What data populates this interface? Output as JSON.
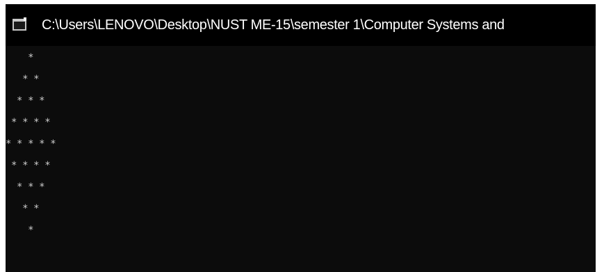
{
  "window": {
    "title": "C:\\Users\\LENOVO\\Desktop\\NUST ME-15\\semester 1\\Computer Systems and",
    "icon": "console-window-icon",
    "background_color": "#0c0c0c",
    "text_color": "#cccccc"
  },
  "console": {
    "lines": [
      "    *",
      "   * *",
      "  * * *",
      " * * * *",
      "* * * * *",
      " * * * *",
      "  * * *",
      "   * *",
      "    *"
    ]
  }
}
